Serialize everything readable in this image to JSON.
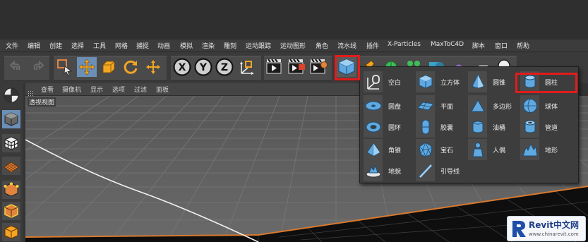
{
  "menu": [
    "文件",
    "编辑",
    "创建",
    "选择",
    "工具",
    "网格",
    "捕捉",
    "动画",
    "模拟",
    "渲染",
    "雕刻",
    "运动跟踪",
    "运动图形",
    "角色",
    "流水线",
    "插件",
    "X-Particles",
    "MaxToC4D",
    "脚本",
    "窗口",
    "帮助"
  ],
  "viewport": {
    "menu": [
      "查看",
      "摄像机",
      "显示",
      "选项",
      "过滤",
      "面板"
    ],
    "label": "透视视图"
  },
  "toolbar": {
    "axis_x": "X",
    "axis_y": "Y",
    "axis_z": "Z"
  },
  "popup": {
    "items": [
      "空白",
      "立方体",
      "圆锥",
      "圆柱",
      "圆盘",
      "平面",
      "多边形",
      "球体",
      "圆环",
      "胶囊",
      "油桶",
      "管道",
      "角锥",
      "宝石",
      "人偶",
      "地形",
      "地貌",
      "引导线"
    ],
    "highlighted": "圆柱"
  },
  "highlight_color": "#e31b1b",
  "accent_blue": "#5fa8e0",
  "watermark": {
    "brand": "Revit中文网",
    "url": "www.chinarevit.com"
  }
}
